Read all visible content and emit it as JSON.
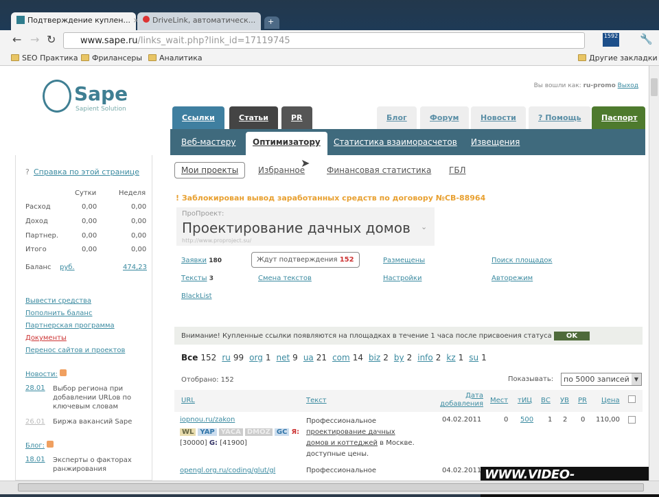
{
  "browser": {
    "tabs": [
      {
        "label": "Подтверждение куплен...",
        "active": true
      },
      {
        "label": "DriveLink, автоматическ...",
        "active": false
      }
    ],
    "url_host": "www.sape.ru",
    "url_path": "/links_wait.php?link_id=17119745",
    "bookmarks": [
      "SEO Практика",
      "Фрилансеры",
      "Аналитика"
    ],
    "other_bookmarks": "Другие закладки"
  },
  "header": {
    "logo": "Sape",
    "logo_sub": "Sapient Solution",
    "login_text": "Вы вошли как:",
    "username": "ru-promo",
    "logout": "Выход",
    "main_tabs": [
      "Ссылки",
      "Статьи",
      "PR"
    ],
    "right_tabs": [
      "Блог",
      "Форум",
      "Новости",
      "? Помощь"
    ],
    "passport": "Паспорт",
    "subnav": [
      "Веб-мастеру",
      "Оптимизатору",
      "Статистика взаиморасчетов",
      "Извещения"
    ]
  },
  "sidebar": {
    "help": "Справка по этой странице",
    "cols": [
      "Сутки",
      "Неделя"
    ],
    "rows": [
      {
        "label": "Расход",
        "d": "0,00",
        "w": "0,00"
      },
      {
        "label": "Доход",
        "d": "0,00",
        "w": "0,00"
      },
      {
        "label": "Партнер.",
        "d": "0,00",
        "w": "0,00"
      },
      {
        "label": "Итого",
        "d": "0,00",
        "w": "0,00"
      }
    ],
    "balance_label": "Баланс",
    "balance_currency": "руб.",
    "balance": "474,23",
    "links": [
      "Вывести средства",
      "Пополнить баланс",
      "Партнерская программа",
      "Документы",
      "Перенос сайтов и проектов"
    ],
    "news_title": "Новости:",
    "news": [
      {
        "date": "28.01",
        "text": "Выбор региона при добавлении URLов по ключевым словам"
      },
      {
        "date": "26.01",
        "text": "Биржа вакансий Sape"
      }
    ],
    "blog_title": "Блог:",
    "blog": [
      {
        "date": "18.01",
        "text": "Эксперты о факторах ранжирования"
      }
    ]
  },
  "main": {
    "subtabs": [
      "Мои проекты",
      "Избранное",
      "Финансовая статистика",
      "ГБЛ"
    ],
    "warning": "Заблокирован вывод заработанных средств по договору №СВ-88964",
    "project_label": "ПроПроект:",
    "project_name": "Проектирование дачных домов",
    "project_url": "http://www.proproject.su/",
    "links": {
      "zayavki": "Заявки",
      "zayavki_count": "180",
      "wait": "Ждут подтверждения",
      "wait_count": "152",
      "placed": "Размещены",
      "search": "Поиск площадок",
      "texts": "Тексты",
      "texts_count": "3",
      "change": "Смена текстов",
      "settings": "Настройки",
      "auto": "Авторежим",
      "blacklist": "BlackList"
    },
    "notice": "Внимание! Купленные ссылки появляются на площадках в течение 1 часа после присвоения статуса",
    "notice_btn": "OK",
    "zones": [
      {
        "z": "Все",
        "n": "152"
      },
      {
        "z": "ru",
        "n": "99"
      },
      {
        "z": "org",
        "n": "1"
      },
      {
        "z": "net",
        "n": "9"
      },
      {
        "z": "ua",
        "n": "21"
      },
      {
        "z": "com",
        "n": "14"
      },
      {
        "z": "biz",
        "n": "2"
      },
      {
        "z": "by",
        "n": "2"
      },
      {
        "z": "info",
        "n": "2"
      },
      {
        "z": "kz",
        "n": "1"
      },
      {
        "z": "su",
        "n": "1"
      }
    ],
    "selected": "Отобрано: 152",
    "show_label": "Показывать:",
    "show_value": "по 5000 записей",
    "table": {
      "headers": [
        "URL",
        "Текст",
        "Дата добавления",
        "Мест",
        "тИЦ",
        "ВС",
        "УВ",
        "PR",
        "Цена"
      ],
      "rows": [
        {
          "url": "iopnou.ru/zakon",
          "badges": [
            "WL",
            "YAP",
            "YACA",
            "DMOZ",
            "GC"
          ],
          "ya": "Я:",
          "ya_val": "[30000]",
          "g": "G:",
          "g_val": "[41900]",
          "text1": "Профессиональное",
          "text_link": "проектирование дачных домов и коттеджей",
          "text2": "в Москве. доступные цены.",
          "date": "04.02.2011",
          "mest": "0",
          "tic": "500",
          "vs": "1",
          "uv": "2",
          "pr": "0",
          "price": "110,00"
        },
        {
          "url": "opengl.org.ru/coding/glut/gl",
          "text1": "Профессиональное",
          "date": "04.02.2011"
        }
      ]
    }
  },
  "watermark": "WWW.VIDEO-SHKOLA.COM"
}
